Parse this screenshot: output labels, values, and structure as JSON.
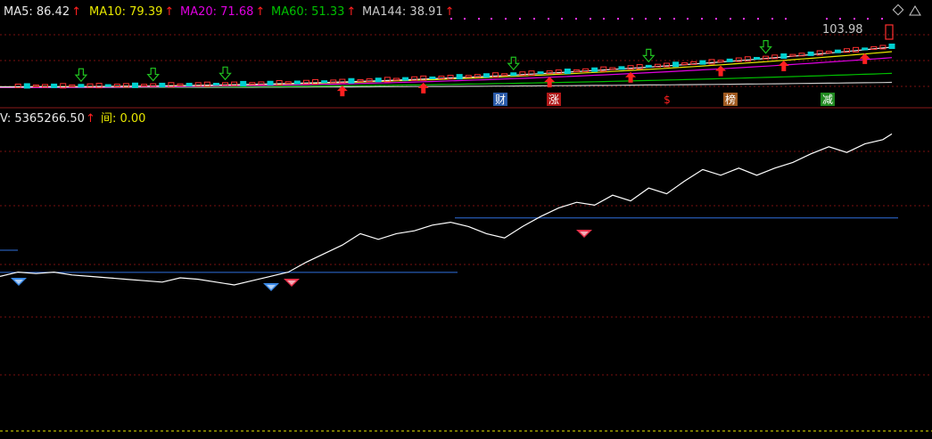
{
  "colors": {
    "bg": "#000000",
    "grid": "#7a1010",
    "border": "#8a1a1a",
    "ma5": "#e8e8e8",
    "ma10": "#e8e800",
    "ma20": "#e000e0",
    "ma60": "#00c000",
    "ma144": "#c8c8c8",
    "up_arrow": "#ff2020",
    "down_arrow": "#20c020",
    "vline": "#ffffff",
    "hline": "#2f6fdd",
    "label_yellow": "#e8e800",
    "price_label": "#c8c8c8"
  },
  "top_panel": {
    "legend": [
      {
        "text": "MA5: 86.42",
        "color": "#e8e8e8"
      },
      {
        "text": "MA10: 79.39",
        "color": "#e8e800"
      },
      {
        "text": "MA20: 71.68",
        "color": "#e000e0"
      },
      {
        "text": "MA60: 51.33",
        "color": "#00c000"
      },
      {
        "text": "MA144: 38.91",
        "color": "#c8c8c8"
      }
    ],
    "price_label": "103.98",
    "markers": [
      {
        "text": "财",
        "bg": "#2a5aa8"
      },
      {
        "text": "涨",
        "bg": "#b01818"
      },
      {
        "text": "$",
        "bg": "#000000",
        "fg": "#ff2020"
      },
      {
        "text": "榜",
        "bg": "#a05a20"
      },
      {
        "text": "减",
        "bg": "#208a20"
      }
    ],
    "up_arrow_idx": [
      38,
      47,
      61,
      70,
      80,
      87,
      96
    ],
    "down_arrow_idx": [
      9,
      17,
      25,
      57,
      72,
      85
    ]
  },
  "bottom_panel": {
    "legend_main": "V: 5365266.50",
    "legend_label": "间: 0.00"
  },
  "chart_data": [
    {
      "type": "line",
      "panel": "top",
      "series": [
        {
          "name": "MA5",
          "values": [
            86.42
          ]
        },
        {
          "name": "MA10",
          "values": [
            79.39
          ]
        },
        {
          "name": "MA20",
          "values": [
            71.68
          ]
        },
        {
          "name": "MA60",
          "values": [
            51.33
          ]
        },
        {
          "name": "MA144",
          "values": [
            38.91
          ]
        }
      ],
      "last_price": 103.98
    },
    {
      "type": "line",
      "panel": "bottom",
      "x": [
        0,
        2,
        4,
        6,
        8,
        10,
        12,
        14,
        16,
        18,
        20,
        22,
        24,
        26,
        28,
        30,
        32,
        34,
        36,
        38,
        40,
        42,
        44,
        46,
        48,
        50,
        52,
        54,
        56,
        58,
        60,
        62,
        64,
        66,
        68,
        70,
        72,
        74,
        76,
        78,
        80,
        82,
        84,
        86,
        88,
        90,
        92,
        94,
        96,
        98,
        99
      ],
      "values": [
        0.1,
        0.13,
        0.12,
        0.13,
        0.11,
        0.1,
        0.09,
        0.08,
        0.07,
        0.06,
        0.09,
        0.08,
        0.06,
        0.04,
        0.07,
        0.1,
        0.13,
        0.2,
        0.26,
        0.32,
        0.4,
        0.36,
        0.4,
        0.42,
        0.46,
        0.48,
        0.45,
        0.4,
        0.37,
        0.45,
        0.52,
        0.58,
        0.62,
        0.6,
        0.67,
        0.63,
        0.72,
        0.68,
        0.77,
        0.85,
        0.81,
        0.86,
        0.81,
        0.86,
        0.9,
        0.96,
        1.01,
        0.97,
        1.03,
        1.06,
        1.1
      ],
      "levels": [
        0.128,
        0.51
      ],
      "signals_blue": [
        1,
        30
      ],
      "signals_red": [
        32,
        65
      ]
    }
  ]
}
